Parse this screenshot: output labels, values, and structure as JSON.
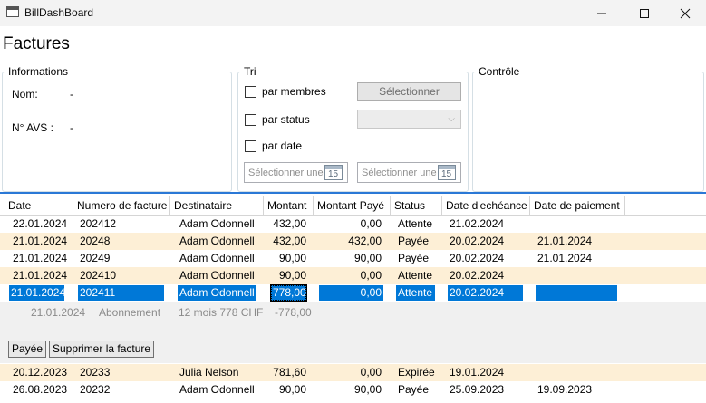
{
  "window": {
    "title": "BillDashBoard",
    "controls": [
      "minimize-icon",
      "maximize-icon",
      "close-icon"
    ]
  },
  "page": {
    "title": "Factures"
  },
  "informations": {
    "legend": "Informations",
    "nom_label": "Nom:",
    "nom_value": "-",
    "avs_label": "N° AVS :",
    "avs_value": "-"
  },
  "tri": {
    "legend": "Tri",
    "by_members_label": "par membres",
    "select_button": "Sélectionner",
    "by_status_label": "par status",
    "status_selected": "",
    "by_date_label": "par date",
    "date_start_placeholder": "Sélectionner une date",
    "date_end_placeholder": "Sélectionner une date",
    "calendar_day": "15"
  },
  "controle": {
    "legend": "Contrôle"
  },
  "grid": {
    "columns": [
      "Date",
      "Numero de facture",
      "Destinataire",
      "Montant",
      "Montant Payé",
      "Status",
      "Date d'echéance",
      "Date de paiement"
    ],
    "rows": [
      {
        "date": "22.01.2024",
        "numero": "202412",
        "destinataire": "Adam Odonnell",
        "montant": "432,00",
        "paye": "0,00",
        "status": "Attente",
        "echeance": "21.02.2024",
        "paiement": ""
      },
      {
        "date": "21.01.2024",
        "numero": "20248",
        "destinataire": "Adam Odonnell",
        "montant": "432,00",
        "paye": "432,00",
        "status": "Payée",
        "echeance": "20.02.2024",
        "paiement": "21.01.2024"
      },
      {
        "date": "21.01.2024",
        "numero": "20249",
        "destinataire": "Adam Odonnell",
        "montant": "90,00",
        "paye": "90,00",
        "status": "Payée",
        "echeance": "20.02.2024",
        "paiement": "21.01.2024"
      },
      {
        "date": "21.01.2024",
        "numero": "202410",
        "destinataire": "Adam Odonnell",
        "montant": "90,00",
        "paye": "0,00",
        "status": "Attente",
        "echeance": "20.02.2024",
        "paiement": ""
      },
      {
        "date": "21.01.2024",
        "numero": "202411",
        "destinataire": "Adam Odonnell",
        "montant": "778,00",
        "paye": "0,00",
        "status": "Attente",
        "echeance": "20.02.2024",
        "paiement": ""
      },
      {
        "date": "20.12.2023",
        "numero": "20233",
        "destinataire": "Julia Nelson",
        "montant": "781,60",
        "paye": "0,00",
        "status": "Expirée",
        "echeance": "19.01.2024",
        "paiement": ""
      },
      {
        "date": "26.08.2023",
        "numero": "20232",
        "destinataire": "Adam Odonnell",
        "montant": "90,00",
        "paye": "90,00",
        "status": "Payée",
        "echeance": "25.09.2023",
        "paiement": "19.09.2023"
      }
    ],
    "details": {
      "date": "21.01.2024",
      "type": "Abonnement",
      "description": "12 mois 778 CHF",
      "amount": "-778,00",
      "paid_button": "Payée",
      "delete_button": "Supprimer la facture"
    }
  },
  "colors": {
    "row_alt": "#fdefd6",
    "selection": "#0078d7",
    "grid_accent": "#2a78d6",
    "details_bg": "#f0f0f0"
  }
}
